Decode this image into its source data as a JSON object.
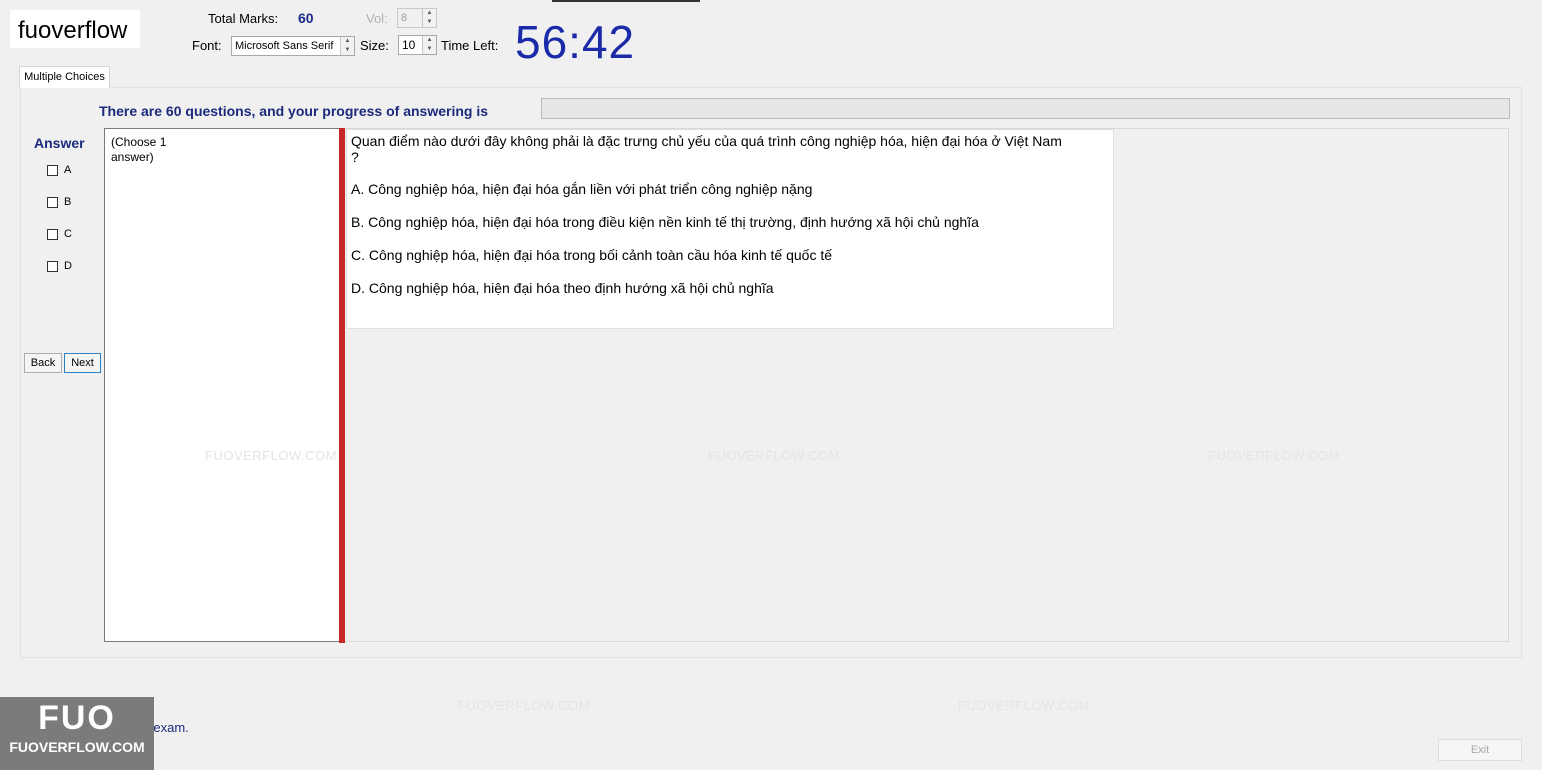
{
  "brand": {
    "logo_text": "fuoverflow",
    "badge_big": "FUO",
    "badge_small": "FUOVERFLOW.COM"
  },
  "header": {
    "total_marks_label": "Total Marks:",
    "total_marks_value": "60",
    "vol_label": "Vol:",
    "vol_value": "8",
    "font_label": "Font:",
    "font_value": "Microsoft Sans Serif",
    "size_label": "Size:",
    "size_value": "10",
    "time_left_label": "Time Left:",
    "timer": "56:42"
  },
  "tabs": [
    {
      "label": "Multiple Choices"
    }
  ],
  "progress": {
    "text": "There are 60 questions, and your progress of answering is"
  },
  "answer": {
    "heading": "Answer",
    "options": [
      "A",
      "B",
      "C",
      "D"
    ],
    "choose_hint": "(Choose 1\nanswer)"
  },
  "nav": {
    "back_label": "Back",
    "next_label": "Next"
  },
  "question": {
    "text": "Quan điểm nào dưới đây không phải là đặc trưng chủ yếu của quá trình công nghiệp hóa, hiện đại hóa ở Việt Nam ?",
    "answers": [
      "A.  Công nghiệp hóa, hiện đại hóa gắn liền với phát triển công nghiệp nặng",
      "B.  Công nghiệp hóa, hiện đại hóa trong điều kiện nền kinh tế thị trường, định hướng xã hội chủ nghĩa",
      "C.  Công nghiệp hóa, hiện đại hóa trong bối cảnh toàn cầu hóa kinh tế quốc tế",
      "D.  Công nghiệp hóa, hiện đại hóa theo định hướng xã hội chủ nghĩa"
    ]
  },
  "watermark": {
    "text": "FUOVERFLOW.COM"
  },
  "footer": {
    "finish_label": "I want to finish the exam.",
    "exit_label": "Exit"
  }
}
